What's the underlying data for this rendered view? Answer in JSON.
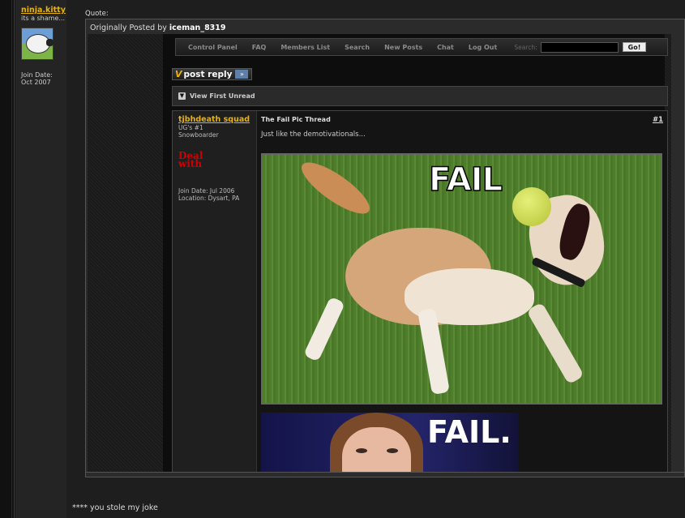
{
  "user": {
    "name": "ninja.kitty",
    "title": "its a shame...",
    "join_label": "Join Date:",
    "join_date": "Oct 2007"
  },
  "quote": {
    "label": "Quote:",
    "byline_prefix": "Originally Posted by",
    "byline_author": "iceman_8319"
  },
  "embedded_forum": {
    "nav": [
      "Control Panel",
      "FAQ",
      "Members List",
      "Search",
      "New Posts",
      "Chat",
      "Log Out"
    ],
    "search_label": "Search:",
    "search_value": "",
    "go_label": "Go!",
    "reply_v": "V",
    "reply_label": "post reply",
    "reply_arrow": "»",
    "view_first_unread": "View First Unread",
    "post": {
      "author": "tjbhdeath squad",
      "author_title_1": "UG's #1",
      "author_title_2": "Snowboarder",
      "badge": "Deal with",
      "join": "Join Date: Jul 2006",
      "location": "Location: Dysart, PA",
      "thread_title": "The Fail Pic Thread",
      "post_number": "#1",
      "text": "Just like the demotivationals...",
      "image1_caption": "FAIL",
      "image2_caption": "FAIL."
    }
  },
  "reply_text": "**** you stole my joke"
}
